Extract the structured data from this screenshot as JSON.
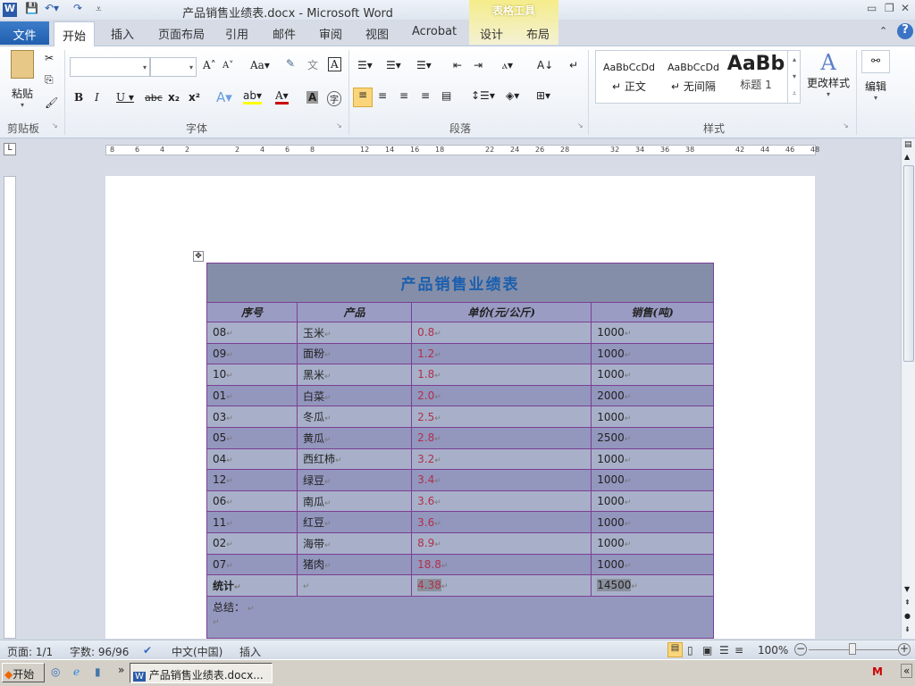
{
  "window": {
    "title": "产品销售业绩表.docx - Microsoft Word",
    "context_tab": "表格工具"
  },
  "tabs": {
    "file": "文件",
    "items": [
      "开始",
      "插入",
      "页面布局",
      "引用",
      "邮件",
      "审阅",
      "视图",
      "Acrobat",
      "设计",
      "布局"
    ]
  },
  "ribbon": {
    "clipboard": {
      "label": "剪贴板",
      "paste": "粘贴"
    },
    "font": {
      "label": "字体",
      "font_name": "",
      "font_size": ""
    },
    "paragraph": {
      "label": "段落"
    },
    "styles": {
      "label": "样式",
      "items": [
        {
          "preview": "AaBbCcDd",
          "name": "正文"
        },
        {
          "preview": "AaBbCcDd",
          "name": "无间隔"
        },
        {
          "preview": "AaBb",
          "name": "标题 1"
        }
      ],
      "change": "更改样式"
    },
    "editing": {
      "label": "编辑"
    }
  },
  "ruler": {
    "ticks": [
      "8",
      "6",
      "4",
      "2",
      "2",
      "4",
      "6",
      "8",
      "12",
      "14",
      "16",
      "18",
      "22",
      "24",
      "26",
      "28",
      "32",
      "34",
      "36",
      "38",
      "42",
      "44",
      "46",
      "48"
    ]
  },
  "table": {
    "title": "产品销售业绩表",
    "headers": [
      "序号",
      "产品",
      "单价(元/公斤)",
      "销售(吨)"
    ],
    "rows": [
      [
        "08",
        "玉米",
        "0.8",
        "1000"
      ],
      [
        "09",
        "面粉",
        "1.2",
        "1000"
      ],
      [
        "10",
        "黑米",
        "1.8",
        "1000"
      ],
      [
        "01",
        "白菜",
        "2.0",
        "2000"
      ],
      [
        "03",
        "冬瓜",
        "2.5",
        "1000"
      ],
      [
        "05",
        "黄瓜",
        "2.8",
        "2500"
      ],
      [
        "04",
        "西红柿",
        "3.2",
        "1000"
      ],
      [
        "12",
        "绿豆",
        "3.4",
        "1000"
      ],
      [
        "06",
        "南瓜",
        "3.6",
        "1000"
      ],
      [
        "11",
        "红豆",
        "3.6",
        "1000"
      ],
      [
        "02",
        "海带",
        "8.9",
        "1000"
      ],
      [
        "07",
        "猪肉",
        "18.8",
        "1000"
      ]
    ],
    "total": [
      "统计",
      "",
      "4.38",
      "14500"
    ],
    "summary": "总结："
  },
  "status": {
    "page": "页面: 1/1",
    "words": "字数: 96/96",
    "lang": "中文(中国)",
    "mode": "插入",
    "zoom": "100%",
    "zoom_level": 100
  },
  "taskbar": {
    "start": "开始",
    "task": "产品销售业绩表.docx..."
  }
}
